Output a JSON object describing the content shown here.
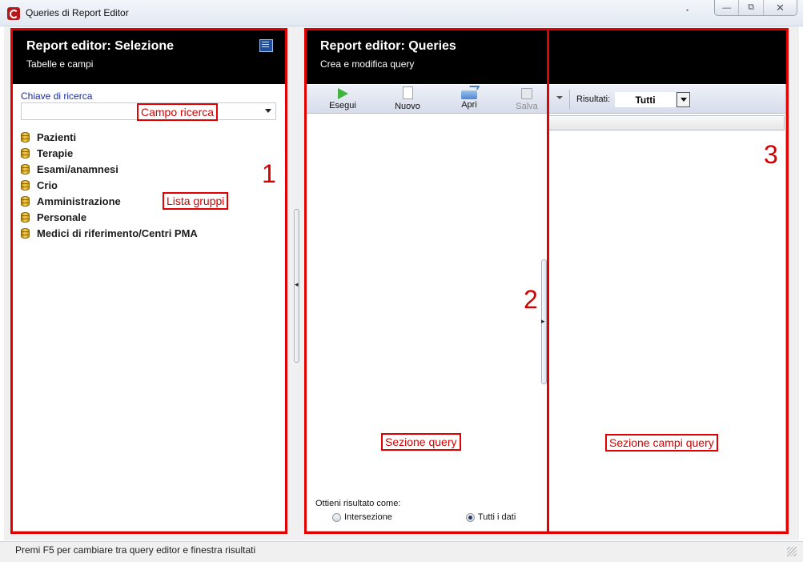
{
  "window": {
    "title": "Queries di Report Editor",
    "minimize_glyph": "—",
    "maximize_glyph": "⧉",
    "close_glyph": "✕"
  },
  "left_panel": {
    "title": "Report editor: Selezione",
    "subtitle": "Tabelle e campi",
    "search_label": "Chiave di ricerca",
    "search_value": "",
    "groups": [
      "Pazienti",
      "Terapie",
      "Esami/anamnesi",
      "Crio",
      "Amministrazione",
      "Personale",
      "Medici di riferimento/Centri PMA"
    ]
  },
  "right_panel": {
    "title": "Report editor: Queries",
    "subtitle": "Crea e modifica query",
    "toolbar": {
      "run_label": "Esegui",
      "new_label": "Nuovo",
      "open_label": "Apri",
      "save_label": "Salva",
      "results_label": "Risultati:",
      "results_value": "Tutti"
    },
    "result_as_label": "Ottieni risultato come:",
    "options": {
      "intersection": "Intersezione",
      "all_data": "Tutti i dati",
      "selected": "all_data"
    }
  },
  "status_bar": {
    "text": "Premi F5 per cambiare tra query editor e finestra risultati"
  },
  "annotations": {
    "color": "#e20000",
    "search_field": "Campo ricerca",
    "group_list": "Lista gruppi",
    "query_section": "Sezione query",
    "query_fields_section": "Sezione campi query",
    "num_1": "1",
    "num_2": "2",
    "num_3": "3"
  },
  "icons": {
    "app": "app-logo-icon",
    "group": "database-icon",
    "header": "panel-menu-icon",
    "run": "play-icon",
    "new": "new-document-icon",
    "open": "open-folder-icon",
    "save": "save-disk-icon"
  }
}
